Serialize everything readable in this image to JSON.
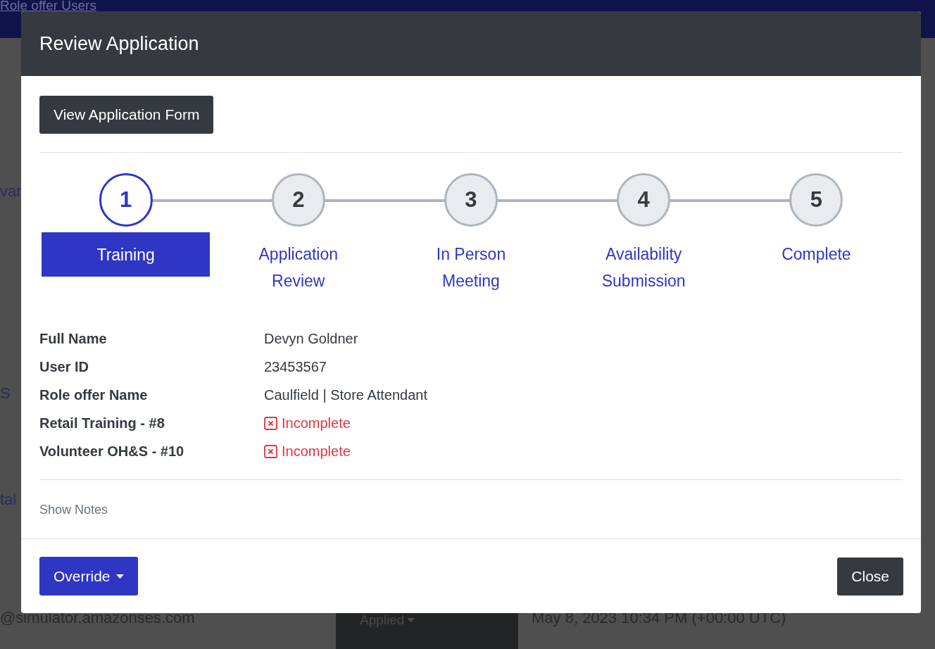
{
  "background": {
    "header_link": "Role offer Users",
    "fragments": [
      "van",
      "S",
      "tal"
    ],
    "email": "@simulator.amazonses.com",
    "status_button": "Applied",
    "date": "May 8, 2023 10:34 PM (+00:00 UTC)"
  },
  "modal": {
    "title": "Review Application",
    "form_button": "View Application Form",
    "steps": [
      {
        "number": "1",
        "label": "Training",
        "selected": true
      },
      {
        "number": "2",
        "label": "Application Review",
        "selected": false
      },
      {
        "number": "3",
        "label": "In Person Meeting",
        "selected": false
      },
      {
        "number": "4",
        "label": "Availability Submission",
        "selected": false
      },
      {
        "number": "5",
        "label": "Complete",
        "selected": false
      }
    ],
    "details": [
      {
        "label": "Full Name",
        "kind": "text",
        "value": "Devyn Goldner"
      },
      {
        "label": "User ID",
        "kind": "text",
        "value": "23453567"
      },
      {
        "label": "Role offer Name",
        "kind": "text",
        "value": "Caulfield | Store Attendant"
      },
      {
        "label": "Retail Training - #8",
        "kind": "status",
        "value": "Incomplete"
      },
      {
        "label": "Volunteer OH&S - #10",
        "kind": "status",
        "value": "Incomplete"
      }
    ],
    "notes_toggle": "Show Notes",
    "override_button": "Override",
    "close_button": "Close"
  }
}
